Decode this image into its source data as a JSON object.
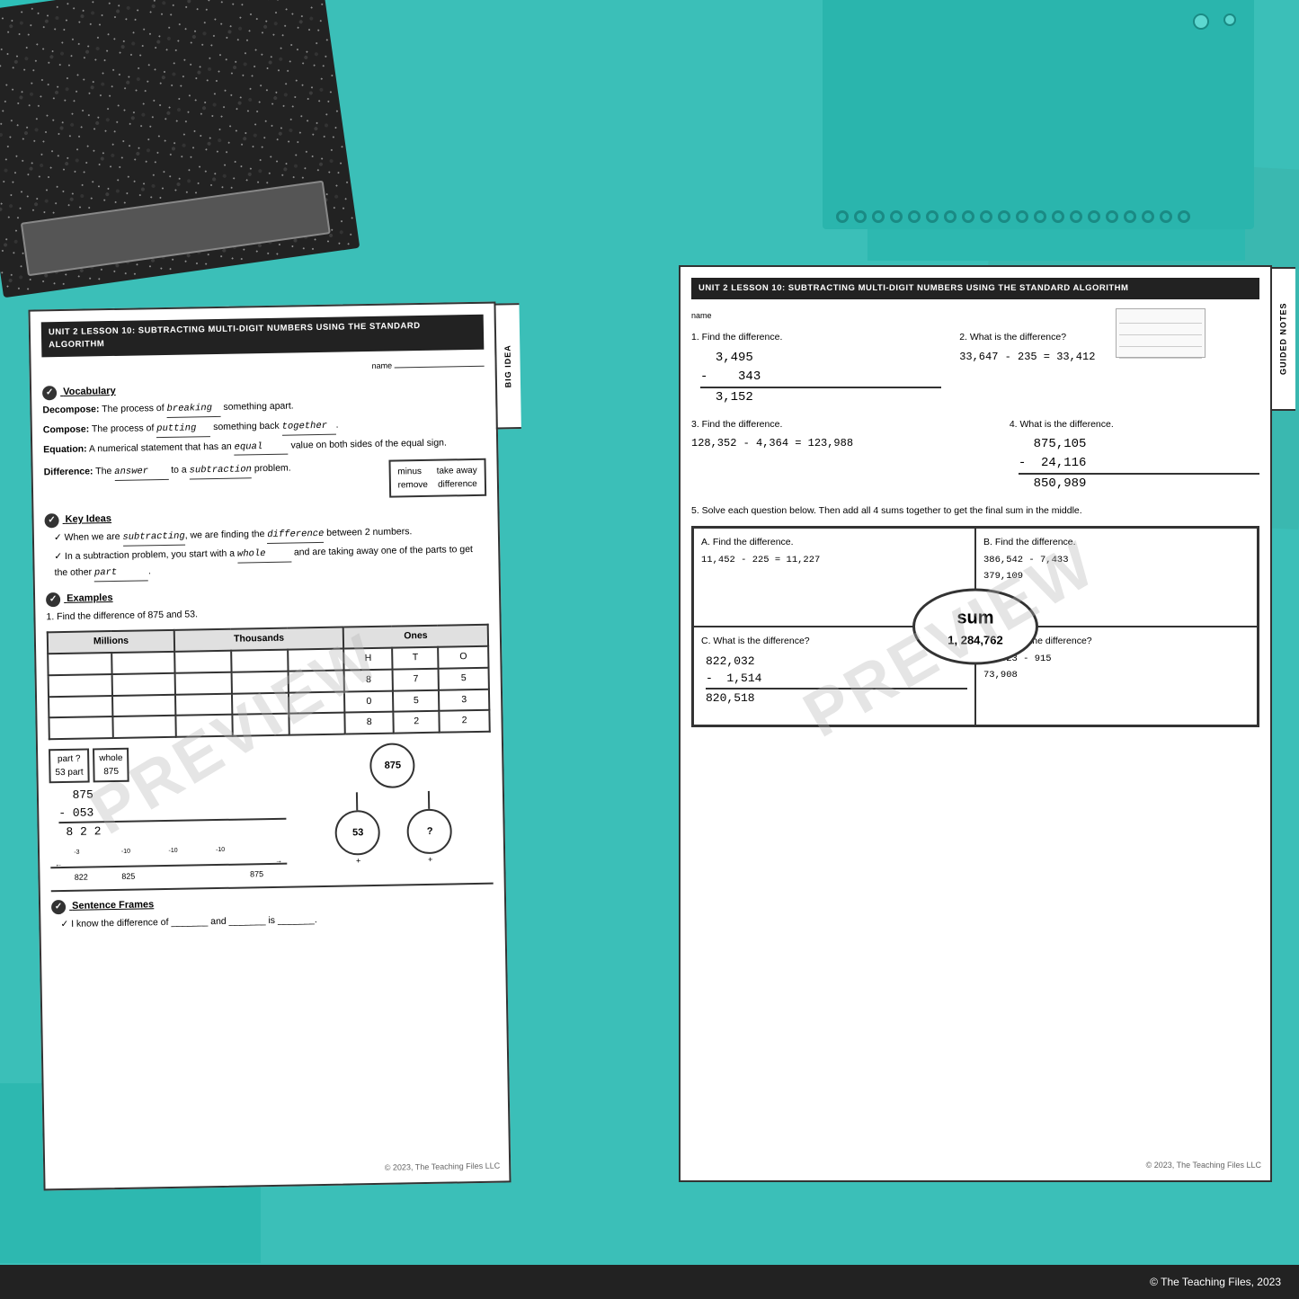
{
  "page": {
    "background_color": "#3bbfb8",
    "bottom_copyright": "© The Teaching Files, 2023"
  },
  "left_worksheet": {
    "header": "UNIT 2 LESSON 10: SUBTRACTING MULTI-DIGIT NUMBERS USING THE STANDARD ALGORITHM",
    "big_idea_tab": "BIG IDEA",
    "name_label": "name",
    "vocabulary_section": {
      "title": "Vocabulary",
      "decompose": "Decompose:",
      "decompose_def": "The process of",
      "decompose_blank": "breaking",
      "decompose_rest": "something apart.",
      "compose": "Compose:",
      "compose_def": "The process of",
      "compose_blank1": "putting",
      "compose_blank2": "something back",
      "compose_blank3": "together",
      "equation": "Equation:",
      "equation_def": "A numerical statement that has an",
      "equation_blank": "equal",
      "equation_rest": "value on both sides of the equal sign.",
      "difference": "Difference:",
      "difference_def": "The",
      "difference_blank1": "answer",
      "difference_blank2": "to a",
      "difference_blank3": "subtraction",
      "difference_rest": "problem.",
      "word_box_items": [
        "minus",
        "take away",
        "remove",
        "difference"
      ]
    },
    "key_ideas_section": {
      "title": "Key Ideas",
      "idea1_start": "When we are",
      "idea1_blank": "subtracting",
      "idea1_mid": ", we are finding the",
      "idea1_blank2": "difference",
      "idea1_end": "between 2 numbers.",
      "idea2_start": "In a subtraction problem, you start with a",
      "idea2_blank": "whole",
      "idea2_mid": "and are taking away one of the parts",
      "idea2_end": "to get the other",
      "idea2_blank2": "part",
      "idea2_period": "."
    },
    "examples_section": {
      "title": "Examples",
      "example1_label": "1. Find the difference of 875 and 53.",
      "table_headers": [
        "Millions",
        "Thousands",
        "Ones"
      ],
      "table_sub_headers": [
        "H",
        "T",
        "O"
      ],
      "table_rows": [
        [
          "",
          "",
          "",
          "8",
          "7",
          "5"
        ],
        [
          "",
          "",
          "",
          "0",
          "5",
          "3"
        ],
        [
          "",
          "",
          "",
          "8",
          "2",
          "2"
        ]
      ],
      "part_whole": {
        "part_label": "part",
        "part_value": "?",
        "part2_label": "part",
        "part2_value": "53",
        "whole_label": "whole",
        "whole_value": "875"
      },
      "subtraction": "875\n- 053\n8 2 2",
      "number_line": "←——-3  -10   -10   -10   -10——→",
      "number_line_values": "822  825                875",
      "tree_top": "875",
      "tree_bottom_left": "53",
      "tree_bottom_right": "?",
      "tree_plus": "+",
      "tree_plus2": "+"
    },
    "sentence_frames_section": {
      "title": "Sentence Frames",
      "frame1": "I know the difference of _______ and _______ is _______."
    },
    "footer": "© 2023, The Teaching Files LLC"
  },
  "right_worksheet": {
    "header": "UNIT 2 LESSON 10: SUBTRACTING MULTI-DIGIT NUMBERS USING THE STANDARD ALGORITHM",
    "guided_notes_tab": "GUIDED NOTES",
    "name_label": "name",
    "problem1": {
      "label": "1. Find the difference.",
      "number1": "3,495",
      "minus": "-",
      "number2": "343",
      "answer": "3,152"
    },
    "problem2": {
      "label": "2. What is the difference?",
      "equation": "33,647 - 235 = 33,412"
    },
    "problem3": {
      "label": "3. Find the difference.",
      "equation": "128,352 - 4,364 = 123,988"
    },
    "problem4": {
      "label": "4. What is the difference.",
      "number1": "875,105",
      "minus": "-",
      "number2": "24,116",
      "answer": "850,989"
    },
    "problem5": {
      "label": "5. Solve each question below. Then add all 4 sums together to get the final sum in the middle.",
      "cell_a_label": "A.  Find the difference.",
      "cell_a_equation": "11,452 - 225 = 11,227",
      "cell_b_label": "B.  Find the difference.",
      "cell_b_equation": "386,542 - 7,433",
      "cell_b_answer": "379,109",
      "sum_label": "sum",
      "sum_value": "1, 284,762",
      "cell_c_label": "C.  What is the difference?",
      "cell_c_number1": "822,032",
      "cell_c_minus": "-",
      "cell_c_number2": "1,514",
      "cell_c_answer": "820,518",
      "cell_d_label": "D.  What is the difference?",
      "cell_d_equation": "74,823 - 915",
      "cell_d_answer": "73,908"
    },
    "footer": "© 2023, The Teaching Files LLC",
    "preview_text": "PREVIEW"
  },
  "bottom_bar": {
    "copyright": "© The Teaching Files, 2023"
  }
}
